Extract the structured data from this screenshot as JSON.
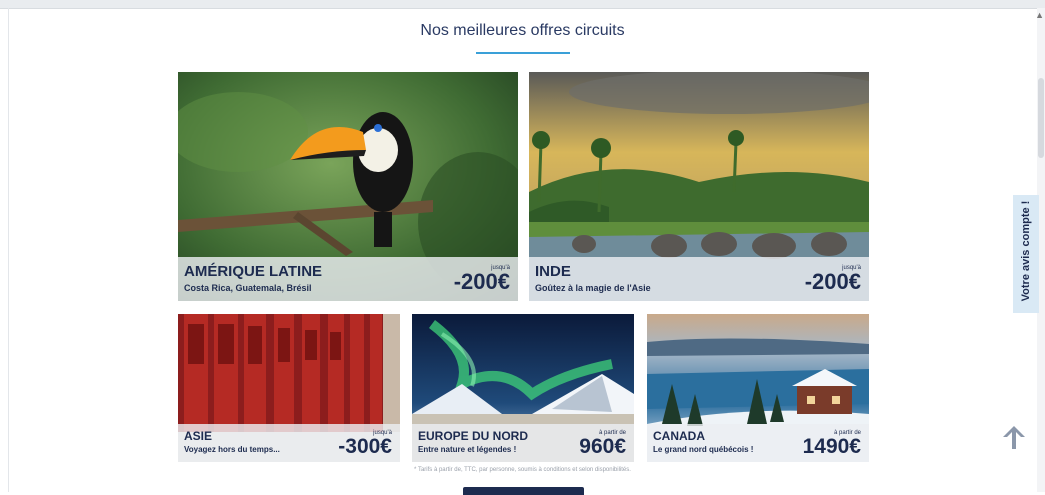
{
  "section": {
    "title": "Nos meilleures offres circuits"
  },
  "offers": [
    {
      "name": "AMÉRIQUE LATINE",
      "subtitle": "Costa Rica, Guatemala, Brésil",
      "prefix": "jusqu'à",
      "price": "-200€"
    },
    {
      "name": "INDE",
      "subtitle": "Goûtez à la magie de l'Asie",
      "prefix": "jusqu'à",
      "price": "-200€"
    },
    {
      "name": "ASIE",
      "subtitle": "Voyagez hors du temps...",
      "prefix": "jusqu'à",
      "price": "-300€"
    },
    {
      "name": "EUROPE DU NORD",
      "subtitle": "Entre nature et légendes !",
      "prefix": "à partir de",
      "price": "960€"
    },
    {
      "name": "CANADA",
      "subtitle": "Le grand nord québécois !",
      "prefix": "à partir de",
      "price": "1490€"
    }
  ],
  "disclaimer": "* Tarifs à partir de, TTC, par personne, soumis à conditions et selon disponibilités.",
  "feedback_tab": {
    "label": "Votre avis compte !"
  },
  "colors": {
    "navy": "#1d2b4f",
    "accent": "#3aa0d8",
    "overlay": "#ebeef2",
    "feedback_bg": "#d9e9f5"
  },
  "icons": {
    "back_to_top": "arrow-up-icon"
  }
}
